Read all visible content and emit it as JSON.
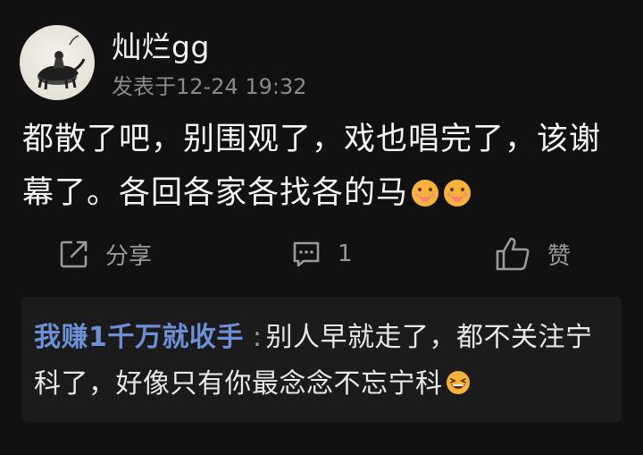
{
  "post": {
    "username": "灿烂gg",
    "meta": "发表于12-24 19:32",
    "content_text": "都散了吧，别围观了，戏也唱完了，该谢幕了。各回各家各找各的马",
    "content_emojis": [
      "hungry-face-emoji",
      "hungry-face-emoji"
    ]
  },
  "actions": {
    "share_label": "分享",
    "comment_count": "1",
    "like_label": "赞"
  },
  "reply": {
    "author": "我赚1千万就收手",
    "separator": ":",
    "text": "别人早就走了，都不关注宁科了，好像只有你最念念不忘宁科",
    "emoji": "laughing-face-emoji"
  },
  "colors": {
    "background": "#111111",
    "reply_background": "#1b1b1b",
    "reply_author": "#6d8fd6",
    "muted": "#8a8a8a"
  }
}
